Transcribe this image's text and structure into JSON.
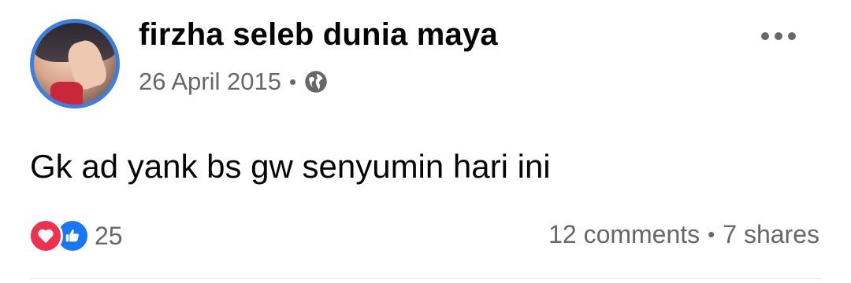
{
  "post": {
    "author_name": "firzha seleb dunia maya",
    "date": "26 April 2015",
    "separator": "•",
    "privacy_icon": "globe-icon",
    "text": "Gk ad yank bs gw senyumin hari ini",
    "reactions": {
      "icons": [
        "love-icon",
        "like-icon"
      ],
      "count": "25"
    },
    "comments": "12 comments",
    "shares": "7 shares"
  },
  "colors": {
    "avatar_ring": "#3b7fe0",
    "secondary_text": "#65676b",
    "love": "#f0304f",
    "like": "#1877f2"
  }
}
